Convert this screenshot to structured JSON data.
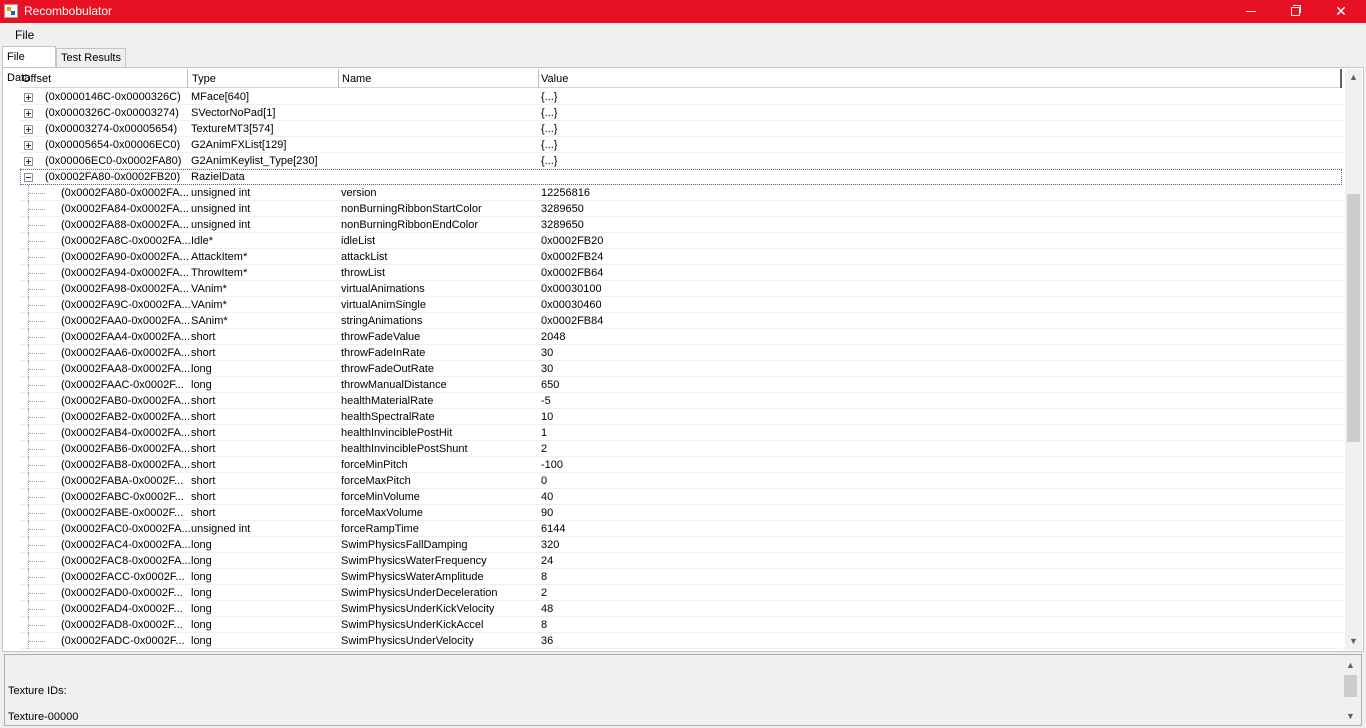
{
  "window": {
    "title": "Recombobulator"
  },
  "menu": {
    "file": "File"
  },
  "tabs": [
    {
      "label": "File Data",
      "active": true
    },
    {
      "label": "Test Results",
      "active": false
    }
  ],
  "columns": {
    "offset": "Offset",
    "type": "Type",
    "name": "Name",
    "value": "Value"
  },
  "rows": [
    {
      "offset": "(0x0000146C-0x0000326C)",
      "type": "MFace[640]",
      "name": "",
      "value": "{...}",
      "level": 0,
      "expander": "plus"
    },
    {
      "offset": "(0x0000326C-0x00003274)",
      "type": "SVectorNoPad[1]",
      "name": "",
      "value": "{...}",
      "level": 0,
      "expander": "plus"
    },
    {
      "offset": "(0x00003274-0x00005654)",
      "type": "TextureMT3[574]",
      "name": "",
      "value": "{...}",
      "level": 0,
      "expander": "plus"
    },
    {
      "offset": "(0x00005654-0x00006EC0)",
      "type": "G2AnimFXList[129]",
      "name": "",
      "value": "{...}",
      "level": 0,
      "expander": "plus"
    },
    {
      "offset": "(0x00006EC0-0x0002FA80)",
      "type": "G2AnimKeylist_Type[230]",
      "name": "",
      "value": "{...}",
      "level": 0,
      "expander": "plus"
    },
    {
      "offset": "(0x0002FA80-0x0002FB20)",
      "type": "RazielData",
      "name": "",
      "value": "",
      "level": 0,
      "expander": "minus",
      "selected": true
    },
    {
      "offset": "(0x0002FA80-0x0002FA...",
      "type": "unsigned int",
      "name": "version",
      "value": "12256816",
      "level": 1
    },
    {
      "offset": "(0x0002FA84-0x0002FA...",
      "type": "unsigned int",
      "name": "nonBurningRibbonStartColor",
      "value": "3289650",
      "level": 1
    },
    {
      "offset": "(0x0002FA88-0x0002FA...",
      "type": "unsigned int",
      "name": "nonBurningRibbonEndColor",
      "value": "3289650",
      "level": 1
    },
    {
      "offset": "(0x0002FA8C-0x0002FA...",
      "type": "Idle*",
      "name": "idleList",
      "value": "0x0002FB20",
      "level": 1
    },
    {
      "offset": "(0x0002FA90-0x0002FA...",
      "type": "AttackItem*",
      "name": "attackList",
      "value": "0x0002FB24",
      "level": 1
    },
    {
      "offset": "(0x0002FA94-0x0002FA...",
      "type": "ThrowItem*",
      "name": "throwList",
      "value": "0x0002FB64",
      "level": 1
    },
    {
      "offset": "(0x0002FA98-0x0002FA...",
      "type": "VAnim*",
      "name": "virtualAnimations",
      "value": "0x00030100",
      "level": 1
    },
    {
      "offset": "(0x0002FA9C-0x0002FA...",
      "type": "VAnim*",
      "name": "virtualAnimSingle",
      "value": "0x00030460",
      "level": 1
    },
    {
      "offset": "(0x0002FAA0-0x0002FA...",
      "type": "SAnim*",
      "name": "stringAnimations",
      "value": "0x0002FB84",
      "level": 1
    },
    {
      "offset": "(0x0002FAA4-0x0002FA...",
      "type": "short",
      "name": "throwFadeValue",
      "value": "2048",
      "level": 1
    },
    {
      "offset": "(0x0002FAA6-0x0002FA...",
      "type": "short",
      "name": "throwFadeInRate",
      "value": "30",
      "level": 1
    },
    {
      "offset": "(0x0002FAA8-0x0002FA...",
      "type": "long",
      "name": "throwFadeOutRate",
      "value": "30",
      "level": 1
    },
    {
      "offset": "(0x0002FAAC-0x0002F...",
      "type": "long",
      "name": "throwManualDistance",
      "value": "650",
      "level": 1
    },
    {
      "offset": "(0x0002FAB0-0x0002FA...",
      "type": "short",
      "name": "healthMaterialRate",
      "value": "-5",
      "level": 1
    },
    {
      "offset": "(0x0002FAB2-0x0002FA...",
      "type": "short",
      "name": "healthSpectralRate",
      "value": "10",
      "level": 1
    },
    {
      "offset": "(0x0002FAB4-0x0002FA...",
      "type": "short",
      "name": "healthInvinciblePostHit",
      "value": "1",
      "level": 1
    },
    {
      "offset": "(0x0002FAB6-0x0002FA...",
      "type": "short",
      "name": "healthInvinciblePostShunt",
      "value": "2",
      "level": 1
    },
    {
      "offset": "(0x0002FAB8-0x0002FA...",
      "type": "short",
      "name": "forceMinPitch",
      "value": "-100",
      "level": 1
    },
    {
      "offset": "(0x0002FABA-0x0002F...",
      "type": "short",
      "name": "forceMaxPitch",
      "value": "0",
      "level": 1
    },
    {
      "offset": "(0x0002FABC-0x0002F...",
      "type": "short",
      "name": "forceMinVolume",
      "value": "40",
      "level": 1
    },
    {
      "offset": "(0x0002FABE-0x0002F...",
      "type": "short",
      "name": "forceMaxVolume",
      "value": "90",
      "level": 1
    },
    {
      "offset": "(0x0002FAC0-0x0002FA...",
      "type": "unsigned int",
      "name": "forceRampTime",
      "value": "6144",
      "level": 1
    },
    {
      "offset": "(0x0002FAC4-0x0002FA...",
      "type": "long",
      "name": "SwimPhysicsFallDamping",
      "value": "320",
      "level": 1
    },
    {
      "offset": "(0x0002FAC8-0x0002FA...",
      "type": "long",
      "name": "SwimPhysicsWaterFrequency",
      "value": "24",
      "level": 1
    },
    {
      "offset": "(0x0002FACC-0x0002F...",
      "type": "long",
      "name": "SwimPhysicsWaterAmplitude",
      "value": "8",
      "level": 1
    },
    {
      "offset": "(0x0002FAD0-0x0002F...",
      "type": "long",
      "name": "SwimPhysicsUnderDeceleration",
      "value": "2",
      "level": 1
    },
    {
      "offset": "(0x0002FAD4-0x0002F...",
      "type": "long",
      "name": "SwimPhysicsUnderKickVelocity",
      "value": "48",
      "level": 1
    },
    {
      "offset": "(0x0002FAD8-0x0002F...",
      "type": "long",
      "name": "SwimPhysicsUnderKickAccel",
      "value": "8",
      "level": 1
    },
    {
      "offset": "(0x0002FADC-0x0002F...",
      "type": "long",
      "name": "SwimPhysicsUnderVelocity",
      "value": "36",
      "level": 1
    }
  ],
  "details": {
    "line1": "Texture IDs:",
    "line2": "Texture-00000"
  },
  "colors": {
    "titlebar": "#e81123",
    "selection_outline": "#4a6fa5"
  }
}
